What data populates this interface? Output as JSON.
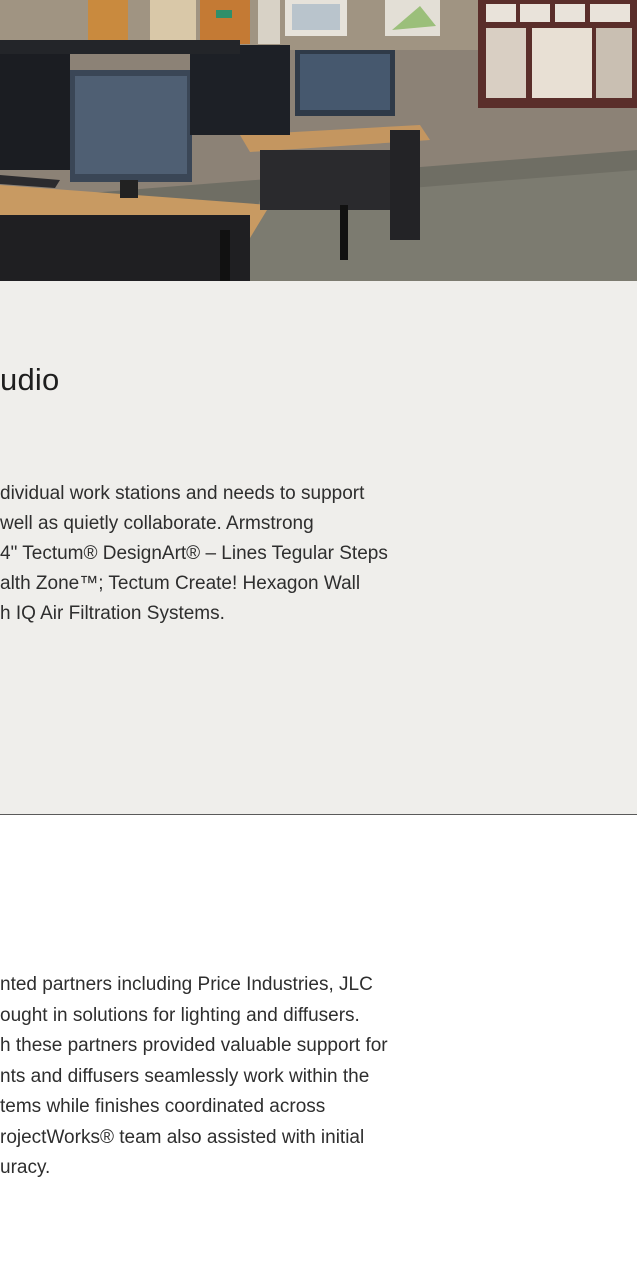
{
  "studio": {
    "title": "udio",
    "body_lines": [
      "dividual work stations and needs to support",
      " well as quietly collaborate. Armstrong",
      "4\" Tectum® DesignArt® – Lines Tegular Steps",
      "alth Zone™; Tectum Create! Hexagon Wall",
      "h IQ Air Filtration Systems."
    ]
  },
  "partners": {
    "body_lines": [
      "nted partners including Price Industries, JLC",
      "ought in solutions for lighting and diffusers.",
      "h these partners provided valuable support for",
      "nts and diffusers seamlessly work within the",
      "tems while finishes coordinated across",
      "rojectWorks® team also assisted with initial",
      "uracy."
    ]
  },
  "colors": {
    "panel_background": "#efeeeb",
    "divider": "#5a5a5a",
    "text": "#2e2e2e"
  }
}
